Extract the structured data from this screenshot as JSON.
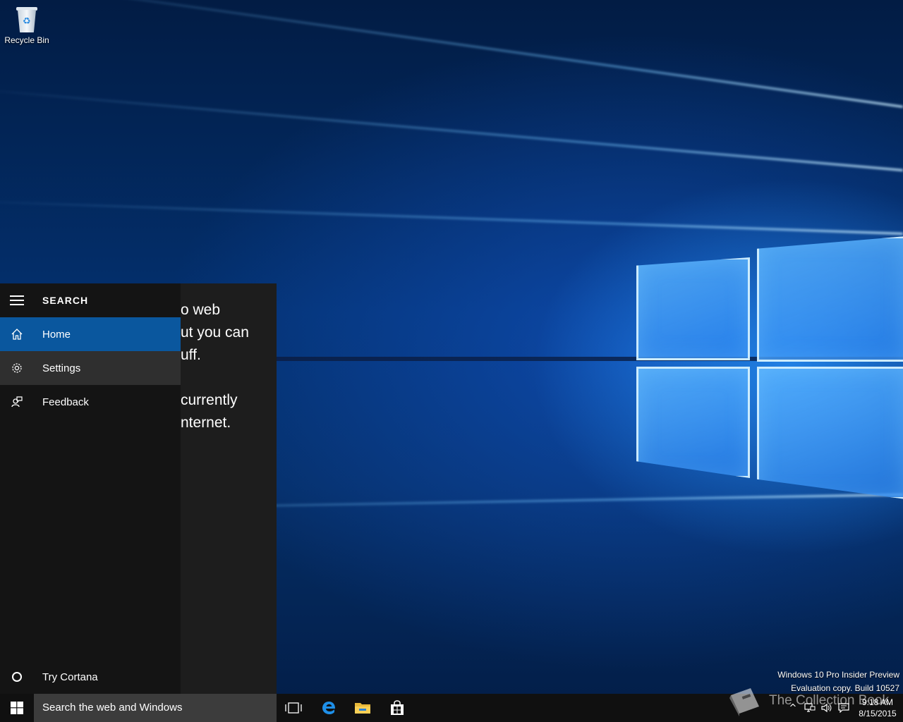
{
  "desktop": {
    "recycle_bin_label": "Recycle Bin",
    "watermark_line1": "Windows 10 Pro Insider Preview",
    "watermark_line2": "Evaluation copy. Build 10527",
    "book_watermark": "The Collection Book"
  },
  "search_flyout": {
    "title": "SEARCH",
    "nav_items": [
      {
        "label": "Home",
        "icon": "home-icon",
        "state": "selected"
      },
      {
        "label": "Settings",
        "icon": "gear-icon",
        "state": "hover"
      },
      {
        "label": "Feedback",
        "icon": "feedback-icon",
        "state": "normal"
      }
    ],
    "try_cortana_label": "Try Cortana",
    "partial_text": [
      "o web",
      "ut you can",
      "uff.",
      "currently",
      "nternet."
    ]
  },
  "taskbar": {
    "search_placeholder": "Search the web and Windows",
    "pinned": [
      "task-view-icon",
      "edge-icon",
      "file-explorer-icon",
      "store-icon"
    ],
    "clock_time": "9:18 AM",
    "clock_date": "8/15/2015"
  },
  "colors": {
    "accent": "#0a579e",
    "taskbar": "#101010",
    "nav_pane": "#141414"
  }
}
